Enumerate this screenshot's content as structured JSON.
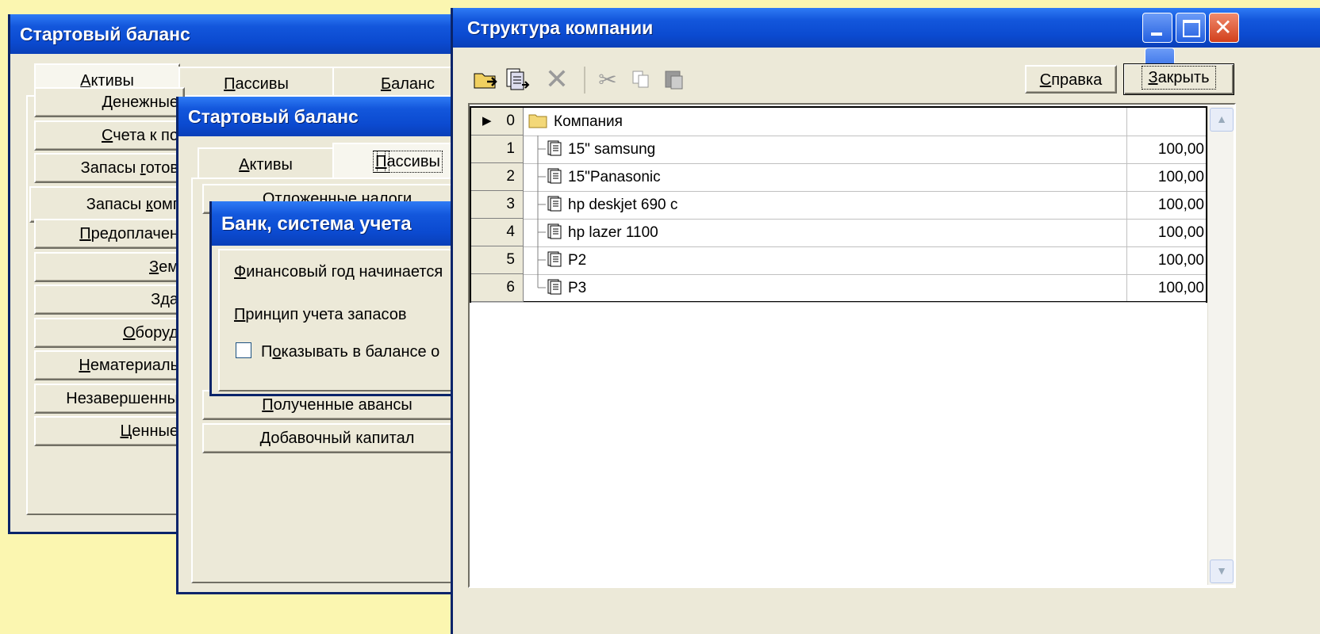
{
  "window1": {
    "title": "Стартовый баланс",
    "tabs": [
      {
        "pre": "",
        "u": "А",
        "post": "ктивы"
      },
      {
        "pre": "",
        "u": "П",
        "post": "ассивы"
      },
      {
        "pre": "",
        "u": "Б",
        "post": "аланс"
      }
    ],
    "buttons": [
      {
        "pre": "Денежные",
        "u": "",
        "post": ""
      },
      {
        "pre": "",
        "u": "С",
        "post": "чета к по"
      },
      {
        "pre": "Запасы ",
        "u": "г",
        "post": "отов"
      },
      {
        "pre": "Запасы ",
        "u": "к",
        "post": "омг"
      },
      {
        "pre": "",
        "u": "П",
        "post": "редоплачен"
      },
      {
        "pre": "",
        "u": "З",
        "post": "ем"
      },
      {
        "pre": "З",
        "u": "д",
        "post": "а"
      },
      {
        "pre": "",
        "u": "О",
        "post": "боруд"
      },
      {
        "pre": "",
        "u": "Н",
        "post": "ематериаль"
      },
      {
        "pre": "Незавершенны",
        "u": "",
        "post": ""
      },
      {
        "pre": "",
        "u": "Ц",
        "post": "енные"
      }
    ]
  },
  "window2": {
    "title": "Стартовый баланс",
    "tabs": [
      {
        "pre": "",
        "u": "А",
        "post": "ктивы"
      },
      {
        "pre": "",
        "u": "П",
        "post": "ассивы"
      }
    ],
    "hidden_button": "Отложенные налоги",
    "buttons": [
      {
        "pre": "",
        "u": "П",
        "post": "олученные авансы"
      },
      {
        "pre": "",
        "u": "Д",
        "post": "обавочный капитал"
      }
    ]
  },
  "window3": {
    "title": "Банк, система учета",
    "fin_year": {
      "pre": "",
      "u": "Ф",
      "post": "инансовый год начинается"
    },
    "principle": {
      "pre": "",
      "u": "П",
      "post": "ринцип учета запасов"
    },
    "checkbox": {
      "pre": "П",
      "u": "о",
      "post": "казывать в балансе о",
      "checked": false
    }
  },
  "company": {
    "title": "Структура компании",
    "help": {
      "pre": "",
      "u": "С",
      "post": "правка"
    },
    "close": {
      "pre": "",
      "u": "З",
      "post": "акрыть"
    },
    "toolbar_icons": [
      "add-folder-icon",
      "add-item-icon",
      "delete-icon",
      "cut-icon",
      "copy-icon",
      "paste-icon"
    ],
    "rows": [
      {
        "num": "0",
        "name": "Компания",
        "value": "",
        "kind": "folder",
        "current": true
      },
      {
        "num": "1",
        "name": "15\" samsung",
        "value": "100,00",
        "kind": "item"
      },
      {
        "num": "2",
        "name": "15\"Panasonic",
        "value": "100,00",
        "kind": "item"
      },
      {
        "num": "3",
        "name": "hp deskjet 690 c",
        "value": "100,00",
        "kind": "item"
      },
      {
        "num": "4",
        "name": "hp lazer 1100",
        "value": "100,00",
        "kind": "item"
      },
      {
        "num": "5",
        "name": "P2",
        "value": "100,00",
        "kind": "item"
      },
      {
        "num": "6",
        "name": "P3",
        "value": "100,00",
        "kind": "item"
      }
    ]
  }
}
